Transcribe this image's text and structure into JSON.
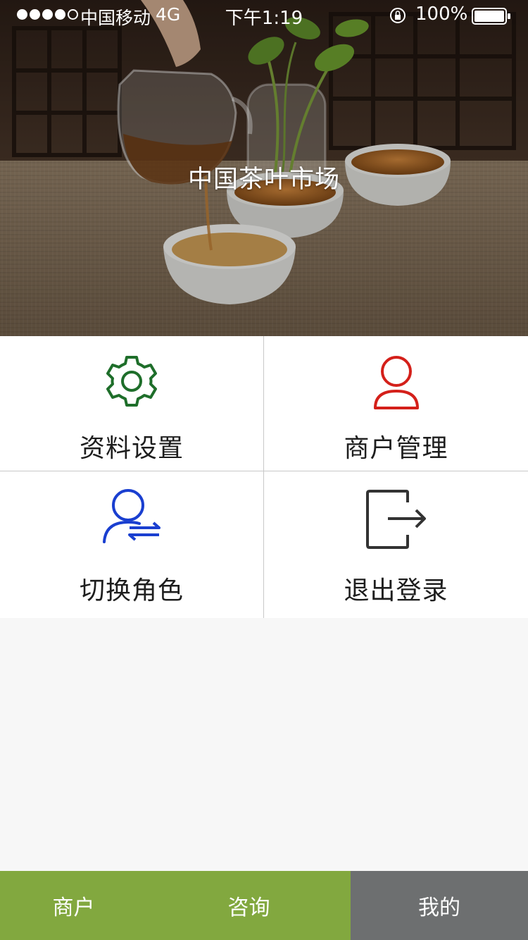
{
  "status_bar": {
    "carrier": "中国移动",
    "network": "4G",
    "time": "下午1:19",
    "battery_percent": "100%",
    "signal_bars": 4,
    "signal_total": 5
  },
  "hero": {
    "title": "中国茶叶市场"
  },
  "menu": {
    "items": [
      {
        "label": "资料设置",
        "icon": "gear-icon",
        "color": "#1e6e2a"
      },
      {
        "label": "商户管理",
        "icon": "user-icon",
        "color": "#d4201a"
      },
      {
        "label": "切换角色",
        "icon": "switch-user-icon",
        "color": "#1a3fd0"
      },
      {
        "label": "退出登录",
        "icon": "logout-icon",
        "color": "#333333"
      }
    ]
  },
  "tab_bar": {
    "tabs": [
      {
        "label": "商户",
        "active": false
      },
      {
        "label": "咨询",
        "active": false
      },
      {
        "label": "我的",
        "active": true
      }
    ],
    "colors": {
      "default": "#82a83f",
      "active": "#6d6f70"
    }
  }
}
